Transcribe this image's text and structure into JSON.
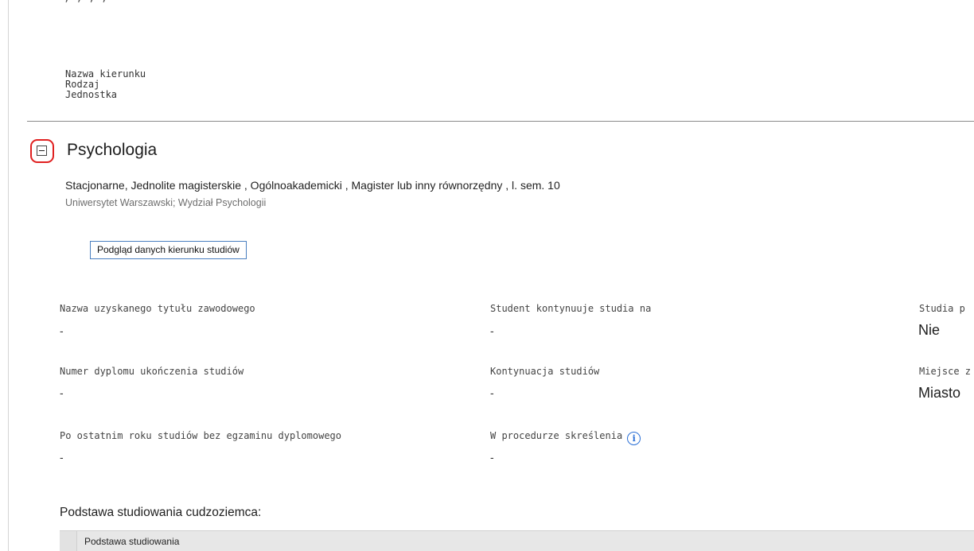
{
  "top_fragment": ", ,   , ,",
  "legend": {
    "line1": "Nazwa kierunku",
    "line2": "Rodzaj",
    "line3": "Jednostka"
  },
  "program": {
    "title": "Psychologia",
    "details": "Stacjonarne, Jednolite magisterskie , Ogólnoakademicki , Magister lub inny równorzędny , l. sem. 10",
    "unit": "Uniwersytet Warszawski; Wydział Psychologii",
    "preview_button": "Podgląd danych kierunku studiów",
    "collapse_icon": "minus-box-icon"
  },
  "fields": {
    "col1": [
      {
        "label": "Nazwa uzyskanego tytułu zawodowego",
        "value": "-"
      },
      {
        "label": "Numer dyplomu ukończenia studiów",
        "value": "-"
      },
      {
        "label": "Po ostatnim roku studiów bez egzaminu dyplomowego",
        "value": "-"
      }
    ],
    "col2": [
      {
        "label": "Student kontynuuje studia na",
        "value": "-"
      },
      {
        "label": "Kontynuacja studiów",
        "value": "-"
      },
      {
        "label": "W procedurze skreślenia",
        "value": "-",
        "info_icon": "i"
      }
    ],
    "col3": [
      {
        "label": "Studia p",
        "value": "Nie"
      },
      {
        "label": "Miejsce z",
        "value": "Miasto"
      }
    ]
  },
  "foreigner_section": {
    "heading": "Podstawa studiowania cudzoziemca:",
    "column_header": "Podstawa studiowania"
  },
  "colors": {
    "highlight_ring": "#e02020",
    "info_icon": "#2a6fd6",
    "button_border": "#4a7fc0"
  }
}
